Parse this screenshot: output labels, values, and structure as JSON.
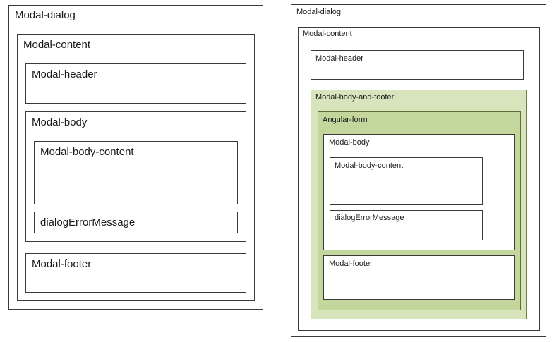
{
  "left": {
    "modal_dialog": "Modal-dialog",
    "modal_content": "Modal-content",
    "modal_header": "Modal-header",
    "modal_body": "Modal-body",
    "modal_body_content": "Modal-body-content",
    "dialog_error_message": "dialogErrorMessage",
    "modal_footer": "Modal-footer"
  },
  "right": {
    "modal_dialog": "Modal-dialog",
    "modal_content": "Modal-content",
    "modal_header": "Modal-header",
    "modal_body_and_footer": "Modal-body-and-footer",
    "angular_form": "Angular-form",
    "modal_body": "Modal-body",
    "modal_body_content": "Modal-body-content",
    "dialog_error_message": "dialogErrorMessage",
    "modal_footer": "Modal-footer"
  },
  "colors": {
    "body_and_footer_fill": "#d8e4bc",
    "angular_form_fill": "#c3d69b"
  }
}
